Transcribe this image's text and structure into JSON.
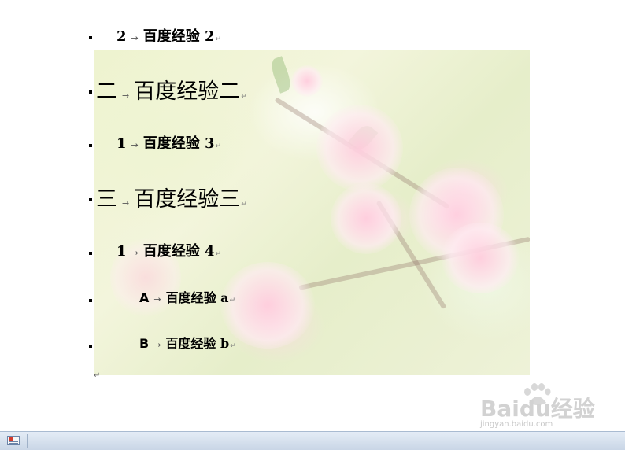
{
  "document": {
    "paragraph_mark": "↵",
    "tab_arrow": "→",
    "items": [
      {
        "level": "2",
        "number": "2",
        "text": "百度经验 2"
      },
      {
        "level": "1",
        "number": "二",
        "text": "百度经验二"
      },
      {
        "level": "2",
        "number": "1",
        "text": "百度经验 3"
      },
      {
        "level": "1",
        "number": "三",
        "text": "百度经验三"
      },
      {
        "level": "2",
        "number": "1",
        "text": "百度经验 4"
      },
      {
        "level": "3",
        "number": "A",
        "text": "百度经验 a"
      },
      {
        "level": "3",
        "number": "B",
        "text": "百度经验 b"
      }
    ]
  },
  "watermark": {
    "brand": "Baidu经验",
    "url": "jingyan.baidu.com"
  },
  "statusbar": {
    "icon": "document-view-icon"
  }
}
